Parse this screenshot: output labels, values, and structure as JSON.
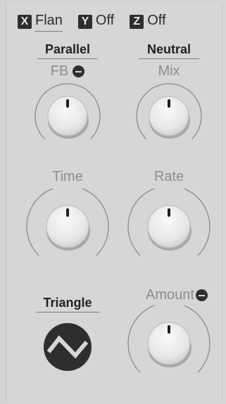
{
  "slots": [
    {
      "key": "X",
      "value": "Flan"
    },
    {
      "key": "Y",
      "value": "Off"
    },
    {
      "key": "Z",
      "value": "Off"
    }
  ],
  "modes": {
    "left": "Parallel",
    "right": "Neutral"
  },
  "params": {
    "fb": "FB",
    "mix": "Mix",
    "time": "Time",
    "rate": "Rate",
    "amount": "Amount"
  },
  "waveform": {
    "label": "Triangle",
    "icon": "triangle-wave-icon"
  },
  "colors": {
    "background": "#d6d6d6",
    "dark": "#2e2e2e",
    "label_gray": "#8d8d8d"
  }
}
